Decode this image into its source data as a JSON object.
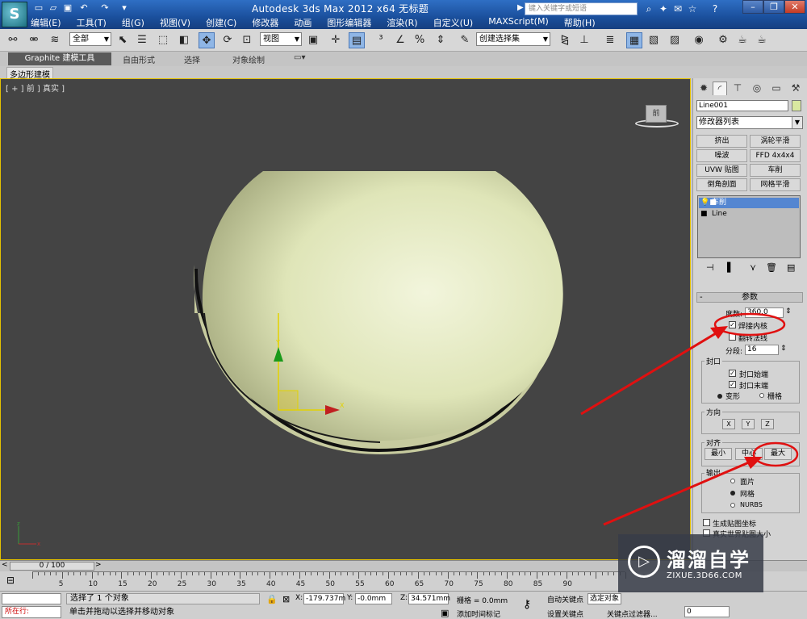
{
  "window": {
    "title": "Autodesk 3ds Max  2012 x64     无标题",
    "search_placeholder": "键入关键字或短语",
    "app_logo_glyph": "S"
  },
  "menu": [
    "编辑(E)",
    "工具(T)",
    "组(G)",
    "视图(V)",
    "创建(C)",
    "修改器",
    "动画",
    "图形编辑器",
    "渲染(R)",
    "自定义(U)",
    "MAXScript(M)",
    "帮助(H)"
  ],
  "toolbar": {
    "selection_filter": "全部",
    "reference_coord": "视图",
    "named_selection": "创建选择集"
  },
  "ribbon": {
    "tabs": [
      "Graphite 建模工具",
      "自由形式",
      "选择",
      "对象绘制"
    ],
    "sub_label": "多边形建模"
  },
  "viewport": {
    "label": "[ + ] 前 ] 真实 ]",
    "viewcube_face": "前",
    "colors": {
      "object": "#e6ebc4",
      "background": "#444444",
      "border": "#e3c000"
    }
  },
  "command_panel": {
    "object_name": "Line001",
    "object_color": "#d9e8a0",
    "modifier_list": "修改器列表",
    "modifier_buttons": [
      "挤出",
      "涡轮平滑",
      "噪波",
      "FFD 4x4x4",
      "UVW 贴图",
      "车削",
      "倒角剖面",
      "网格平滑"
    ],
    "stack": [
      {
        "label": "车削",
        "selected": true
      },
      {
        "label": "Line",
        "selected": false
      }
    ],
    "params": {
      "rollout_title": "参数",
      "degrees_label": "度数:",
      "degrees_value": "360.0",
      "weld_core_label": "焊接内核",
      "weld_core_checked": true,
      "flip_normals_label": "翻转法线",
      "flip_normals_checked": false,
      "segments_label": "分段:",
      "segments_value": "16",
      "capping_label": "封口",
      "cap_start_label": "封口始端",
      "cap_start_checked": true,
      "cap_end_label": "封口末端",
      "cap_end_checked": true,
      "morph_label": "变形",
      "grid_label": "栅格",
      "direction_label": "方向",
      "dir_buttons": [
        "X",
        "Y",
        "Z"
      ],
      "align_label": "对齐",
      "align_buttons": [
        "最小",
        "中心",
        "最大"
      ],
      "output_label": "输出",
      "output_options": [
        "面片",
        "网格",
        "NURBS"
      ],
      "output_selected": "网格",
      "gen_map_coords_label": "生成贴图坐标",
      "real_world_label": "真实世界贴图大小"
    }
  },
  "timeline": {
    "thumb": "0 / 100",
    "ticks": [
      5,
      10,
      15,
      20,
      25,
      30,
      35,
      40,
      45,
      50,
      55,
      60,
      65,
      70,
      75,
      80,
      85,
      90
    ]
  },
  "status": {
    "selected_text": "选择了 1 个对象",
    "prompt_text": "单击并拖动以选择并移动对象",
    "add_time_tag": "添加时间标记",
    "running_label": "所在行:",
    "x_label": "X:",
    "x_value": "-179.737m",
    "y_label": "Y:",
    "y_value": "-0.0mm",
    "z_label": "Z:",
    "z_value": "34.571mm",
    "grid_text": "栅格 = 0.0mm",
    "auto_key": "自动关键点",
    "set_key": "设置关键点",
    "selected_obj": "选定对象",
    "key_filters": "关键点过滤器...",
    "frame_value": "0"
  },
  "watermark": {
    "title": "溜溜自学",
    "url": "ZIXUE.3D66.COM"
  },
  "annotation_color": "#e01010"
}
